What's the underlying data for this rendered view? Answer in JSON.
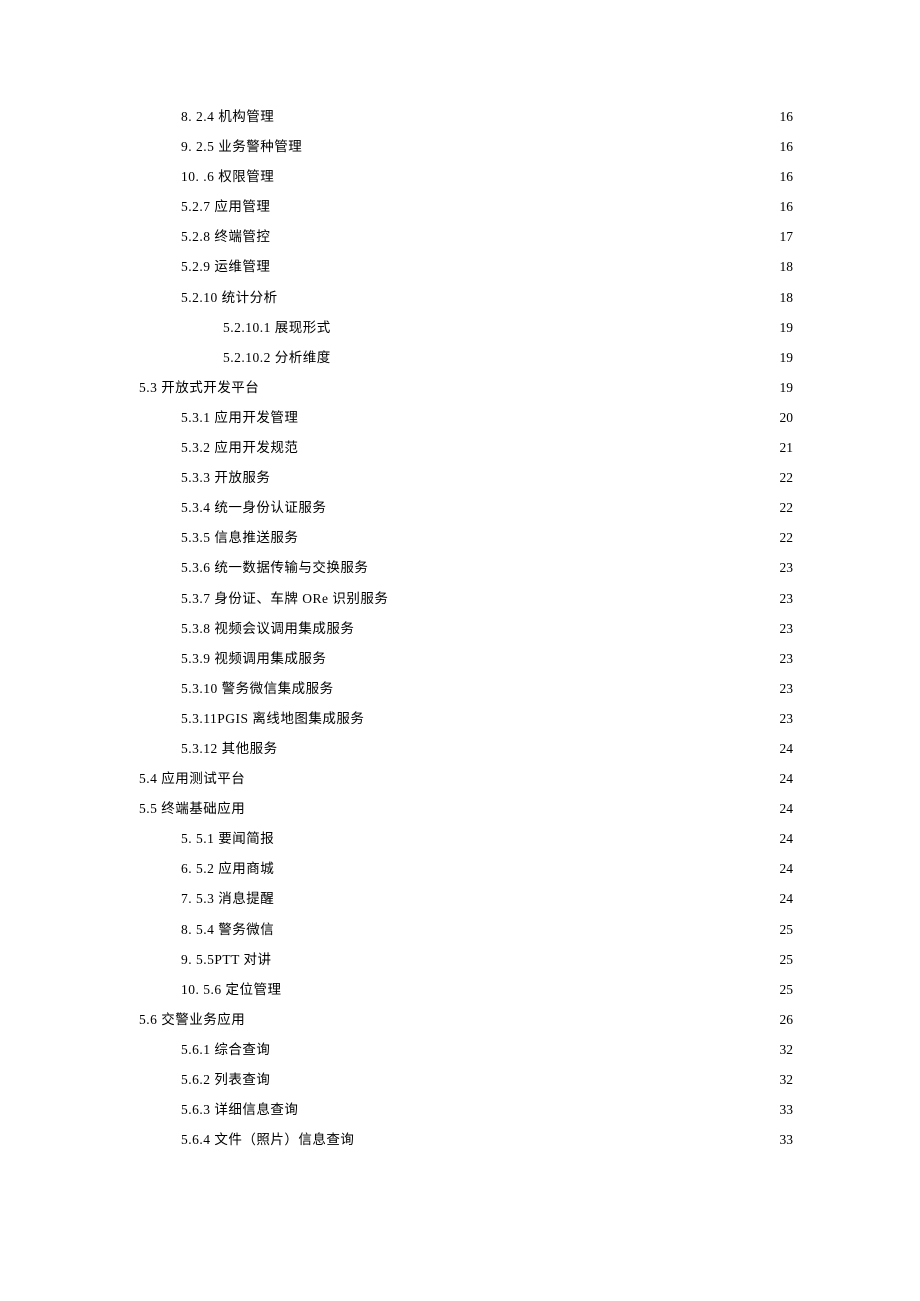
{
  "toc": [
    {
      "indent": 1,
      "label": "8.   2.4 机构管理",
      "page": "16"
    },
    {
      "indent": 1,
      "label": "9.   2.5 业务警种管理",
      "page": "16"
    },
    {
      "indent": 1,
      "label": "10.   .6 权限管理",
      "page": "16"
    },
    {
      "indent": 1,
      "label": "5.2.7 应用管理",
      "page": "16"
    },
    {
      "indent": 1,
      "label": "5.2.8 终端管控",
      "page": "17"
    },
    {
      "indent": 1,
      "label": "5.2.9 运维管理",
      "page": "18"
    },
    {
      "indent": 1,
      "label": "5.2.10 统计分析",
      "page": "18"
    },
    {
      "indent": 2,
      "label": "5.2.10.1 展现形式",
      "page": "19"
    },
    {
      "indent": 2,
      "label": "5.2.10.2 分析维度",
      "page": "19"
    },
    {
      "indent": 0,
      "label": "5.3 开放式开发平台",
      "page": "19"
    },
    {
      "indent": 1,
      "label": "5.3.1 应用开发管理",
      "page": "20"
    },
    {
      "indent": 1,
      "label": "5.3.2 应用开发规范",
      "page": "21"
    },
    {
      "indent": 1,
      "label": "5.3.3 开放服务",
      "page": "22"
    },
    {
      "indent": 1,
      "label": "5.3.4 统一身份认证服务",
      "page": "22"
    },
    {
      "indent": 1,
      "label": "5.3.5 信息推送服务",
      "page": "22"
    },
    {
      "indent": 1,
      "label": "5.3.6 统一数据传输与交换服务",
      "page": "23"
    },
    {
      "indent": 1,
      "label": "5.3.7 身份证、车牌 ORe 识别服务",
      "page": "23"
    },
    {
      "indent": 1,
      "label": "5.3.8 视频会议调用集成服务",
      "page": "23"
    },
    {
      "indent": 1,
      "label": "5.3.9 视频调用集成服务",
      "page": "23"
    },
    {
      "indent": 1,
      "label": "5.3.10 警务微信集成服务",
      "page": "23"
    },
    {
      "indent": 1,
      "label": "5.3.11PGIS 离线地图集成服务",
      "page": "23"
    },
    {
      "indent": 1,
      "label": "5.3.12 其他服务",
      "page": "24"
    },
    {
      "indent": 0,
      "label": "5.4 应用测试平台",
      "page": "24"
    },
    {
      "indent": 0,
      "label": "5.5 终端基础应用",
      "page": "24"
    },
    {
      "indent": 1,
      "label": "5.   5.1 要闻简报",
      "page": "24"
    },
    {
      "indent": 1,
      "label": "6.   5.2 应用商城",
      "page": "24"
    },
    {
      "indent": 1,
      "label": "7.   5.3 消息提醒",
      "page": "24"
    },
    {
      "indent": 1,
      "label": "8.   5.4 警务微信",
      "page": "25"
    },
    {
      "indent": 1,
      "label": "9.   5.5PTT 对讲",
      "page": "25"
    },
    {
      "indent": 1,
      "label": "10. 5.6 定位管理",
      "page": "25"
    },
    {
      "indent": 0,
      "label": "5.6 交警业务应用",
      "page": "26"
    },
    {
      "indent": 1,
      "label": "5.6.1 综合查询",
      "page": "32"
    },
    {
      "indent": 1,
      "label": "5.6.2 列表查询",
      "page": "32"
    },
    {
      "indent": 1,
      "label": "5.6.3 详细信息查询",
      "page": "33"
    },
    {
      "indent": 1,
      "label": "5.6.4 文件（照片）信息查询",
      "page": "33"
    }
  ]
}
